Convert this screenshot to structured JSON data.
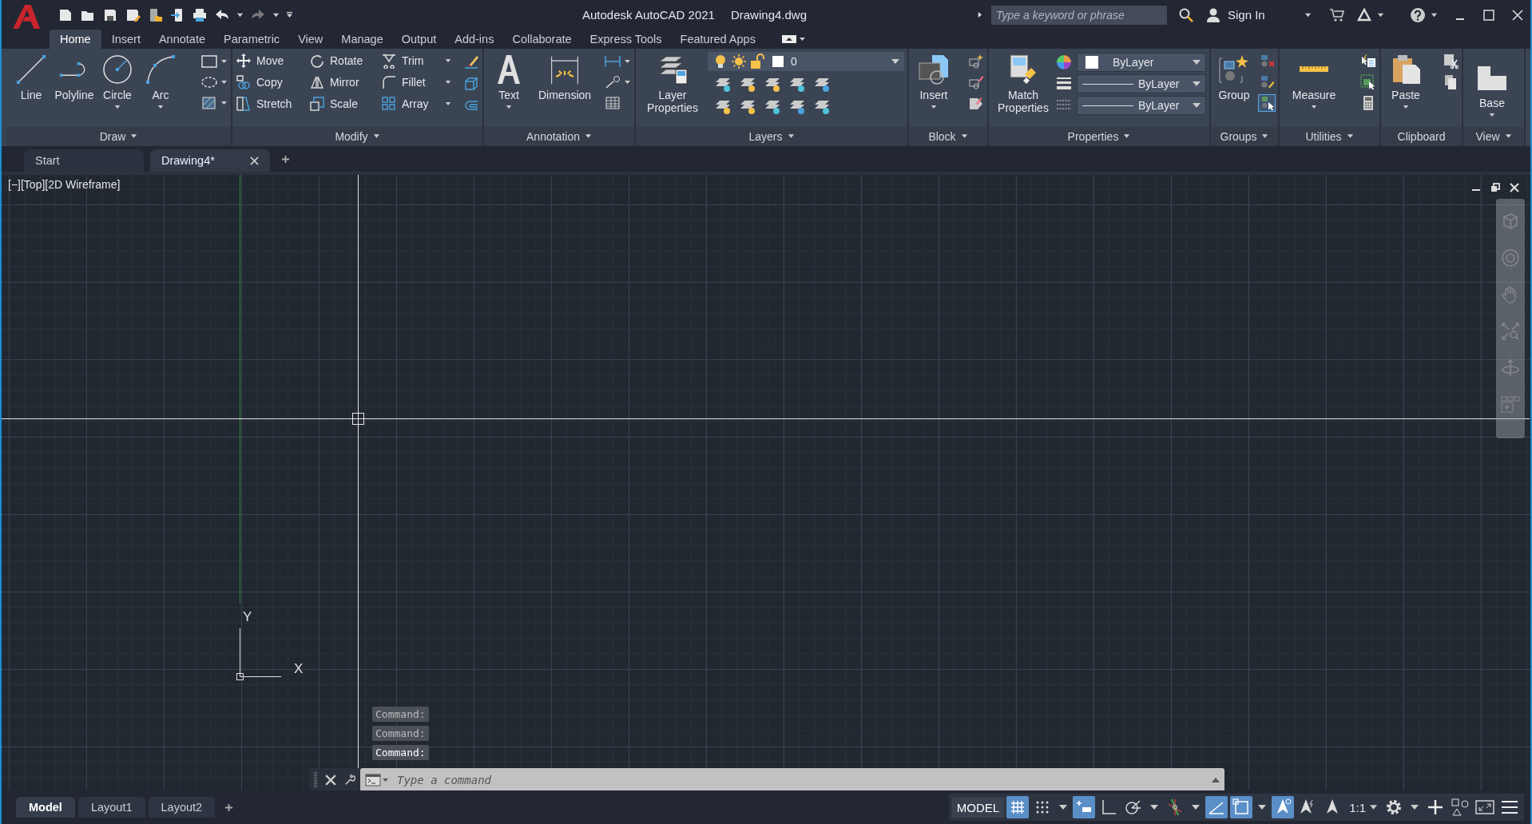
{
  "title_bar": {
    "app_title": "Autodesk AutoCAD 2021",
    "file_name": "Drawing4.dwg",
    "search": {
      "placeholder": "Type a keyword or phrase"
    },
    "sign_in": "Sign In"
  },
  "ribbon_tabs": [
    {
      "label": "Home",
      "selected": true
    },
    {
      "label": "Insert",
      "selected": false
    },
    {
      "label": "Annotate",
      "selected": false
    },
    {
      "label": "Parametric",
      "selected": false
    },
    {
      "label": "View",
      "selected": false
    },
    {
      "label": "Manage",
      "selected": false
    },
    {
      "label": "Output",
      "selected": false
    },
    {
      "label": "Add-ins",
      "selected": false
    },
    {
      "label": "Collaborate",
      "selected": false
    },
    {
      "label": "Express Tools",
      "selected": false
    },
    {
      "label": "Featured Apps",
      "selected": false
    }
  ],
  "panels": {
    "draw": {
      "title": "Draw",
      "tools": [
        "Line",
        "Polyline",
        "Circle",
        "Arc"
      ]
    },
    "modify": {
      "title": "Modify",
      "tools": [
        "Move",
        "Rotate",
        "Trim",
        "Copy",
        "Mirror",
        "Fillet",
        "Stretch",
        "Scale",
        "Array"
      ]
    },
    "annotation": {
      "title": "Annotation",
      "tools": [
        "Text",
        "Dimension"
      ]
    },
    "layers": {
      "title": "Layers",
      "tools": [
        "Layer Properties"
      ],
      "current_layer": "0"
    },
    "block": {
      "title": "Block",
      "tools": [
        "Insert"
      ]
    },
    "properties": {
      "title": "Properties",
      "tools": [
        "Match Properties"
      ],
      "color_setting": "ByLayer",
      "lineweight": "ByLayer",
      "linetype": "ByLayer"
    },
    "groups": {
      "title": "Groups",
      "tools": [
        "Group"
      ]
    },
    "utilities": {
      "title": "Utilities",
      "tools": [
        "Measure"
      ]
    },
    "clipboard": {
      "title": "Clipboard",
      "tools": [
        "Paste"
      ]
    },
    "view": {
      "title": "View",
      "tools": [
        "Base"
      ]
    }
  },
  "document_tabs": [
    {
      "label": "Start",
      "selected": false
    },
    {
      "label": "Drawing4*",
      "selected": true
    }
  ],
  "viewport_controls": [
    "[−]",
    "[Top]",
    "[2D Wireframe]"
  ],
  "ucs": {
    "x": "X",
    "y": "Y"
  },
  "command_history": [
    "Command:",
    "Command:",
    "Command:"
  ],
  "command_line": {
    "placeholder": "Type a command"
  },
  "layout_tabs": [
    {
      "label": "Model",
      "selected": true
    },
    {
      "label": "Layout1",
      "selected": false
    },
    {
      "label": "Layout2",
      "selected": false
    }
  ],
  "status_bar": {
    "space": "MODEL",
    "annotation_scale": "1:1",
    "toggles": [
      {
        "on": true
      },
      {
        "on": false
      },
      {
        "on": true
      },
      {
        "on": false
      },
      {
        "on": false
      },
      {
        "on": false
      },
      {
        "on": true
      },
      {
        "on": true
      },
      {
        "on": true
      },
      {
        "on": false
      },
      {
        "on": false
      }
    ]
  }
}
